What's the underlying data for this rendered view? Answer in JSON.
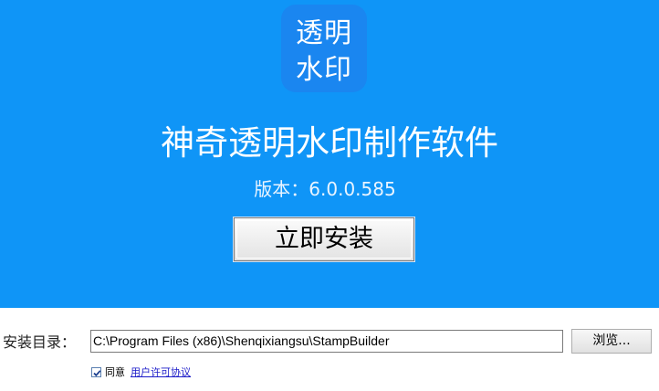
{
  "logo": {
    "line1": "透明",
    "line2": "水印",
    "color": "#1a86f0"
  },
  "header": {
    "title": "神奇透明水印制作软件",
    "version": "版本：6.0.0.585",
    "background": "#0f95f7"
  },
  "install_button": {
    "label": "立即安装"
  },
  "install_dir": {
    "label": "安装目录：",
    "value": "C:\\Program Files (x86)\\Shenqixiangsu\\StampBuilder",
    "browse_label": "浏览..."
  },
  "agreement": {
    "checked": true,
    "label": "同意",
    "link_text": "用户许可协议"
  }
}
